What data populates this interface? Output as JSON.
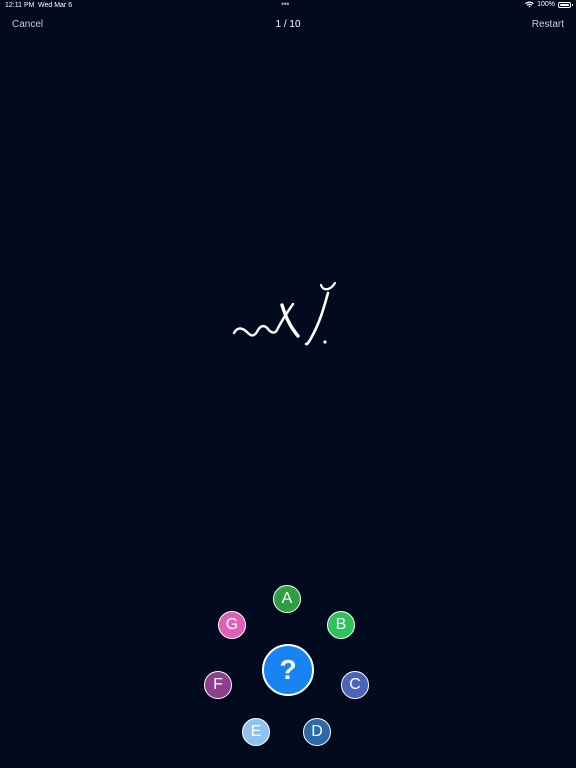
{
  "status": {
    "time": "12:11 PM",
    "date": "Wed Mar 6",
    "dots": "•••",
    "battery": "100%"
  },
  "nav": {
    "cancel": "Cancel",
    "progress": "1 / 10",
    "restart": "Restart"
  },
  "choices": {
    "a": {
      "label": "A",
      "color": "#2e9e44"
    },
    "b": {
      "label": "B",
      "color": "#2fc25a"
    },
    "c": {
      "label": "C",
      "color": "#4c64b8"
    },
    "d": {
      "label": "D",
      "color": "#2c6aa8"
    },
    "e": {
      "label": "E",
      "color": "#8ec3f0"
    },
    "f": {
      "label": "F",
      "color": "#8e3f8e"
    },
    "g": {
      "label": "G",
      "color": "#e060b8"
    }
  },
  "hint": {
    "label": "?",
    "color": "#1784f2"
  },
  "colors": {
    "background": "#020b1d",
    "glyph": "#ffffff"
  }
}
